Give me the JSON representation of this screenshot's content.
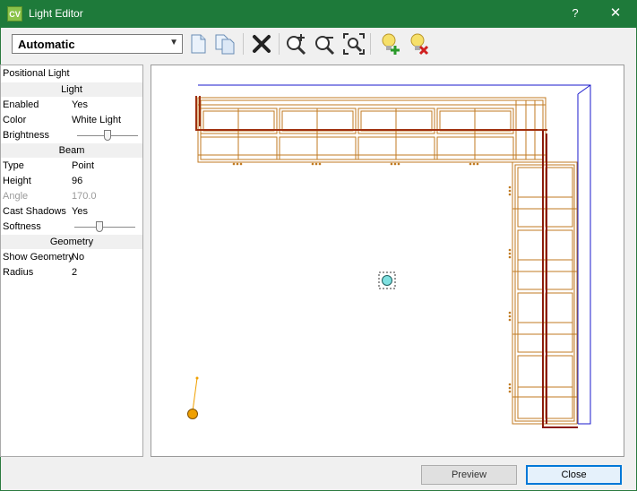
{
  "window": {
    "title": "Light Editor",
    "app_icon": "CV",
    "help": "?",
    "close": "✕"
  },
  "toolbar": {
    "mode_value": "Automatic",
    "icons": [
      "new-light-icon",
      "copy-light-icon",
      "delete-icon",
      "zoom-in-icon",
      "zoom-out-icon",
      "zoom-extents-icon",
      "add-light-icon",
      "remove-light-icon"
    ]
  },
  "panel": {
    "title": "Positional Light",
    "sections": {
      "light": "Light",
      "beam": "Beam",
      "geometry": "Geometry"
    },
    "light": {
      "enabled": {
        "label": "Enabled",
        "value": "Yes"
      },
      "color": {
        "label": "Color",
        "value": "White Light"
      },
      "brightness": {
        "label": "Brightness",
        "level": 0.5
      }
    },
    "beam": {
      "type": {
        "label": "Type",
        "value": "Point"
      },
      "height": {
        "label": "Height",
        "value": "96"
      },
      "angle": {
        "label": "Angle",
        "value": "170.0"
      },
      "cast_shadows": {
        "label": "Cast Shadows",
        "value": "Yes"
      },
      "softness": {
        "label": "Softness",
        "level": 0.4
      }
    },
    "geometry": {
      "show_geometry": {
        "label": "Show Geometry",
        "value": "No"
      },
      "radius": {
        "label": "Radius",
        "value": "2"
      }
    }
  },
  "buttons": {
    "preview": "Preview",
    "close": "Close"
  },
  "colors": {
    "title_bar": "#1e7a3a",
    "cabinet": "#c07a20",
    "cabinet_dark": "#8b1a0a",
    "room_outline": "#1a1acc",
    "light_marker": "#7fe0e0",
    "camera": "#f0a000"
  }
}
